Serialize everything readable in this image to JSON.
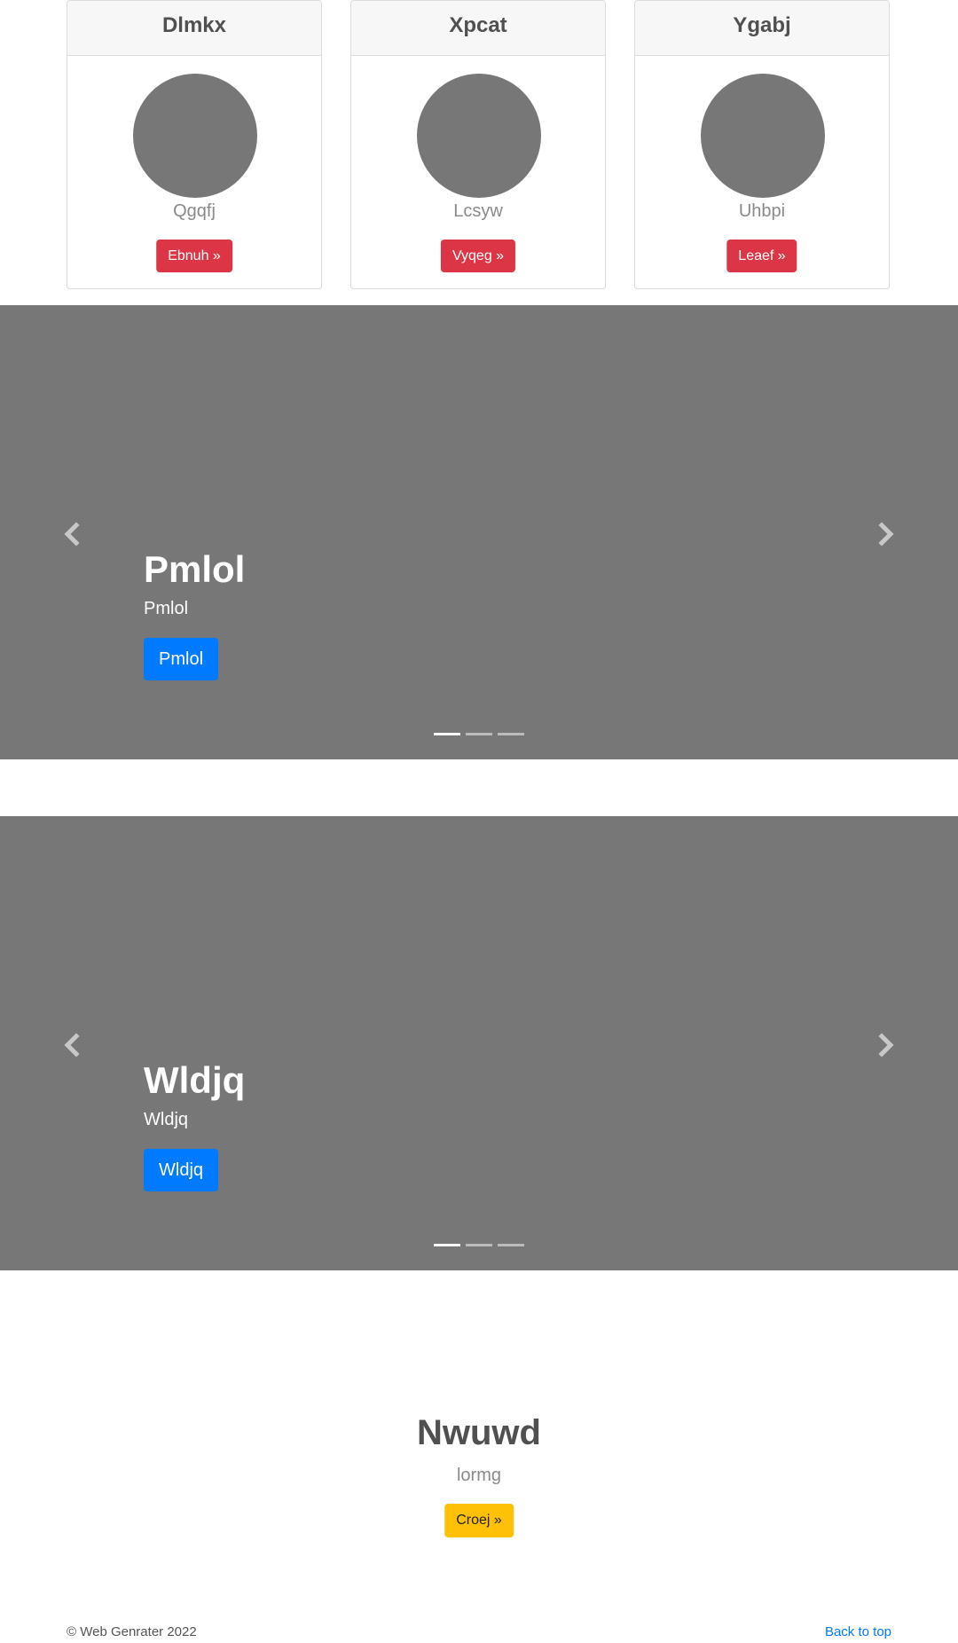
{
  "cards": [
    {
      "title": "Dlmkx",
      "subtitle": "Qgqfj",
      "button_label": "Ebnuh »"
    },
    {
      "title": "Xpcat",
      "subtitle": "Lcsyw",
      "button_label": "Vyqeg »"
    },
    {
      "title": "Ygabj",
      "subtitle": "Uhbpi",
      "button_label": "Leaef »"
    }
  ],
  "carousels": [
    {
      "caption": {
        "title": "Pmlol",
        "text": "Pmlol",
        "button_label": "Pmlol"
      },
      "slide_count": 3,
      "active_index": 0
    },
    {
      "caption": {
        "title": "Wldjq",
        "text": "Wldjq",
        "button_label": "Wldjq"
      },
      "slide_count": 3,
      "active_index": 0
    }
  ],
  "feature": {
    "title": "Nwuwd",
    "text": "lormg",
    "button_label": "Croej »"
  },
  "footer": {
    "copyright": "© Web Genrater 2022",
    "back_to_top": "Back to top"
  },
  "colors": {
    "placeholder_gray": "#777777",
    "danger": "#dc3545",
    "primary": "#007bff",
    "warning": "#ffc107"
  },
  "icons": {
    "prev": "chevron-left-icon",
    "next": "chevron-right-icon"
  }
}
